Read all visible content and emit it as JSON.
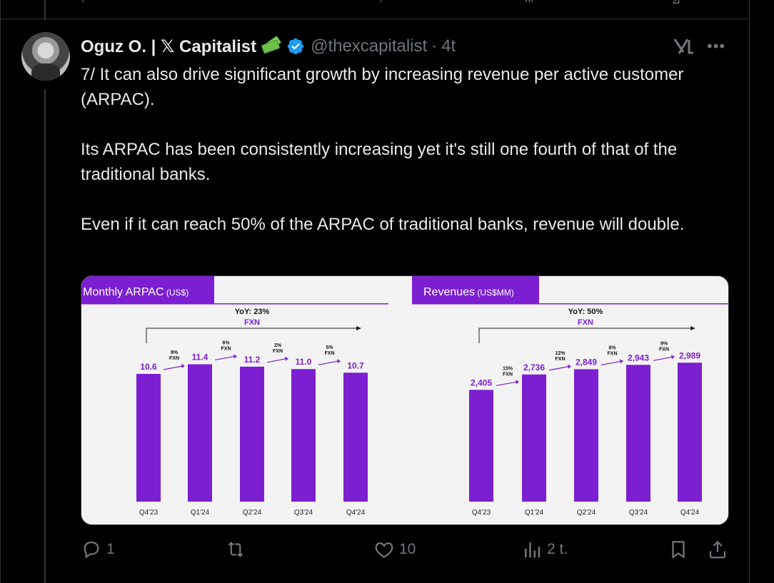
{
  "tweet": {
    "display_name": "Oguz O. | 𝕏 Capitalist",
    "handle": "@thexcapitalist",
    "separator": "·",
    "time": "4t",
    "text": [
      "7/ It can also drive significant growth by increasing revenue per active customer (ARPAC).",
      "Its ARPAC has been consistently increasing yet it's still one fourth of that of the traditional banks.",
      "Even if it can reach 50% of the ARPAC of traditional banks, revenue will double."
    ],
    "icons": [
      "verified-badge-icon",
      "grok-icon",
      "more-icon",
      "money-emoji-icon",
      "avatar"
    ]
  },
  "actions": {
    "reply": "1",
    "retweet": "",
    "like": "10",
    "views": "2 t.",
    "icons": [
      "reply-icon",
      "retweet-icon",
      "like-icon",
      "views-icon",
      "bookmark-icon",
      "share-icon"
    ]
  },
  "colors": {
    "accent_purple": "#7b1fd1",
    "verified_blue": "#1d9bf0",
    "muted": "#71767b"
  },
  "chart_data": [
    {
      "type": "bar",
      "title": "Monthly ARPAC",
      "title_unit": "(US$)",
      "categories": [
        "Q4'23",
        "Q1'24",
        "Q2'24",
        "Q3'24",
        "Q4'24"
      ],
      "values": [
        10.6,
        11.4,
        11.2,
        11.0,
        10.7
      ],
      "value_labels": [
        "10.6",
        "11.4",
        "11.2",
        "11.0",
        "10.7"
      ],
      "growth_labels": [
        "8%\nFXN",
        "6%\nFXN",
        "2%\nFXN",
        "5%\nFXN"
      ],
      "yoy_label": "YoY: 23%",
      "yoy_sub": "FXN",
      "ylim": [
        0,
        13.5
      ]
    },
    {
      "type": "bar",
      "title": "Revenues",
      "title_unit": "(US$MM)",
      "categories": [
        "Q4'23",
        "Q1'24",
        "Q2'24",
        "Q3'24",
        "Q4'24"
      ],
      "values": [
        2405,
        2736,
        2849,
        2943,
        2989
      ],
      "value_labels": [
        "2,405",
        "2,736",
        "2,849",
        "2,943",
        "2,989"
      ],
      "growth_labels": [
        "15%\nFXN",
        "12%\nFXN",
        "8%\nFXN",
        "9%\nFXN"
      ],
      "yoy_label": "YoY: 50%",
      "yoy_sub": "FXN",
      "ylim": [
        0,
        3500
      ]
    }
  ]
}
